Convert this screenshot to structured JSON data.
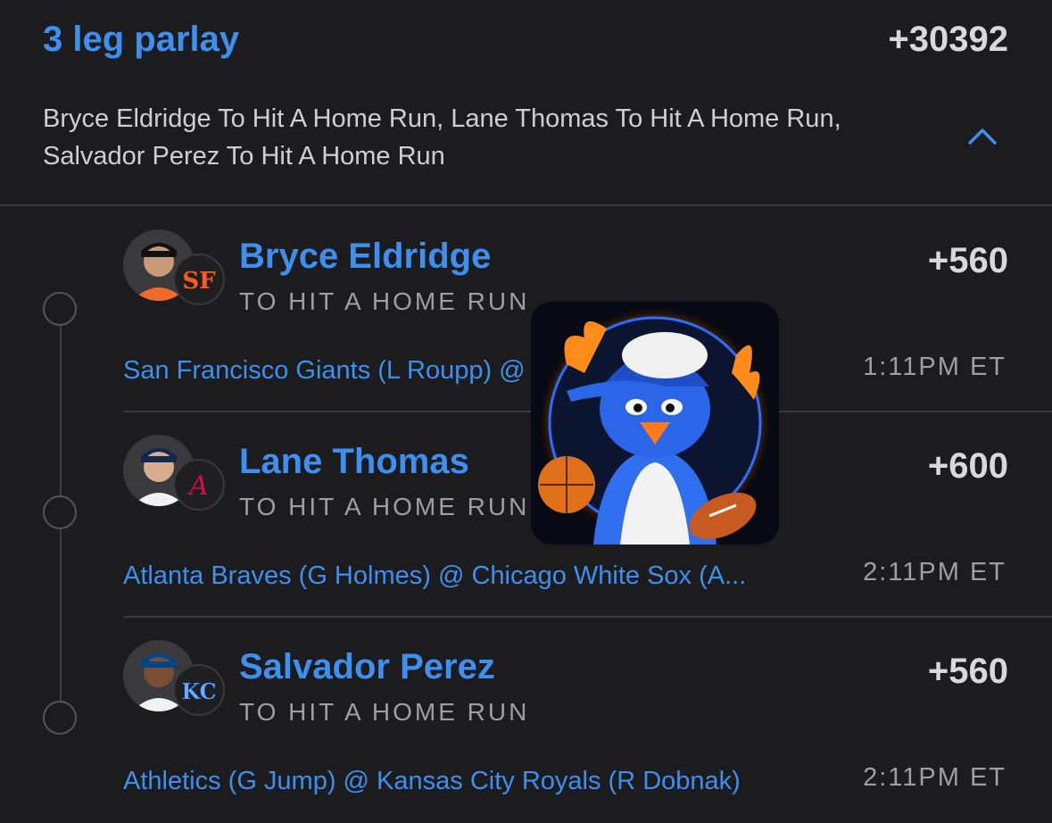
{
  "parlay": {
    "title": "3 leg parlay",
    "odds": "+30392",
    "summary": "Bryce Eldridge To Hit A Home Run, Lane Thomas To Hit A Home Run, Salvador Perez To Hit A Home Run",
    "collapse_icon": "chevron-up-icon"
  },
  "legs": [
    {
      "player": "Bryce Eldridge",
      "market": "TO HIT A HOME RUN",
      "odds": "+560",
      "game": "San Francisco Giants (L Roupp) @ St. Louis Cardi...",
      "time": "1:11PM ET",
      "team_color": "#fd5a1e"
    },
    {
      "player": "Lane Thomas",
      "market": "TO HIT A HOME RUN",
      "odds": "+600",
      "game": "Atlanta Braves (G Holmes) @ Chicago White Sox (A...",
      "time": "2:11PM ET",
      "team_color": "#ce1141"
    },
    {
      "player": "Salvador Perez",
      "market": "TO HIT A HOME RUN",
      "odds": "+560",
      "game": "Athletics (G Jump) @ Kansas City Royals (R Dobnak)",
      "time": "2:11PM ET",
      "team_color": "#004687"
    }
  ],
  "colors": {
    "accent": "#3d8ff0",
    "background": "#1c1c1e",
    "muted_text": "#9e9ea3"
  }
}
